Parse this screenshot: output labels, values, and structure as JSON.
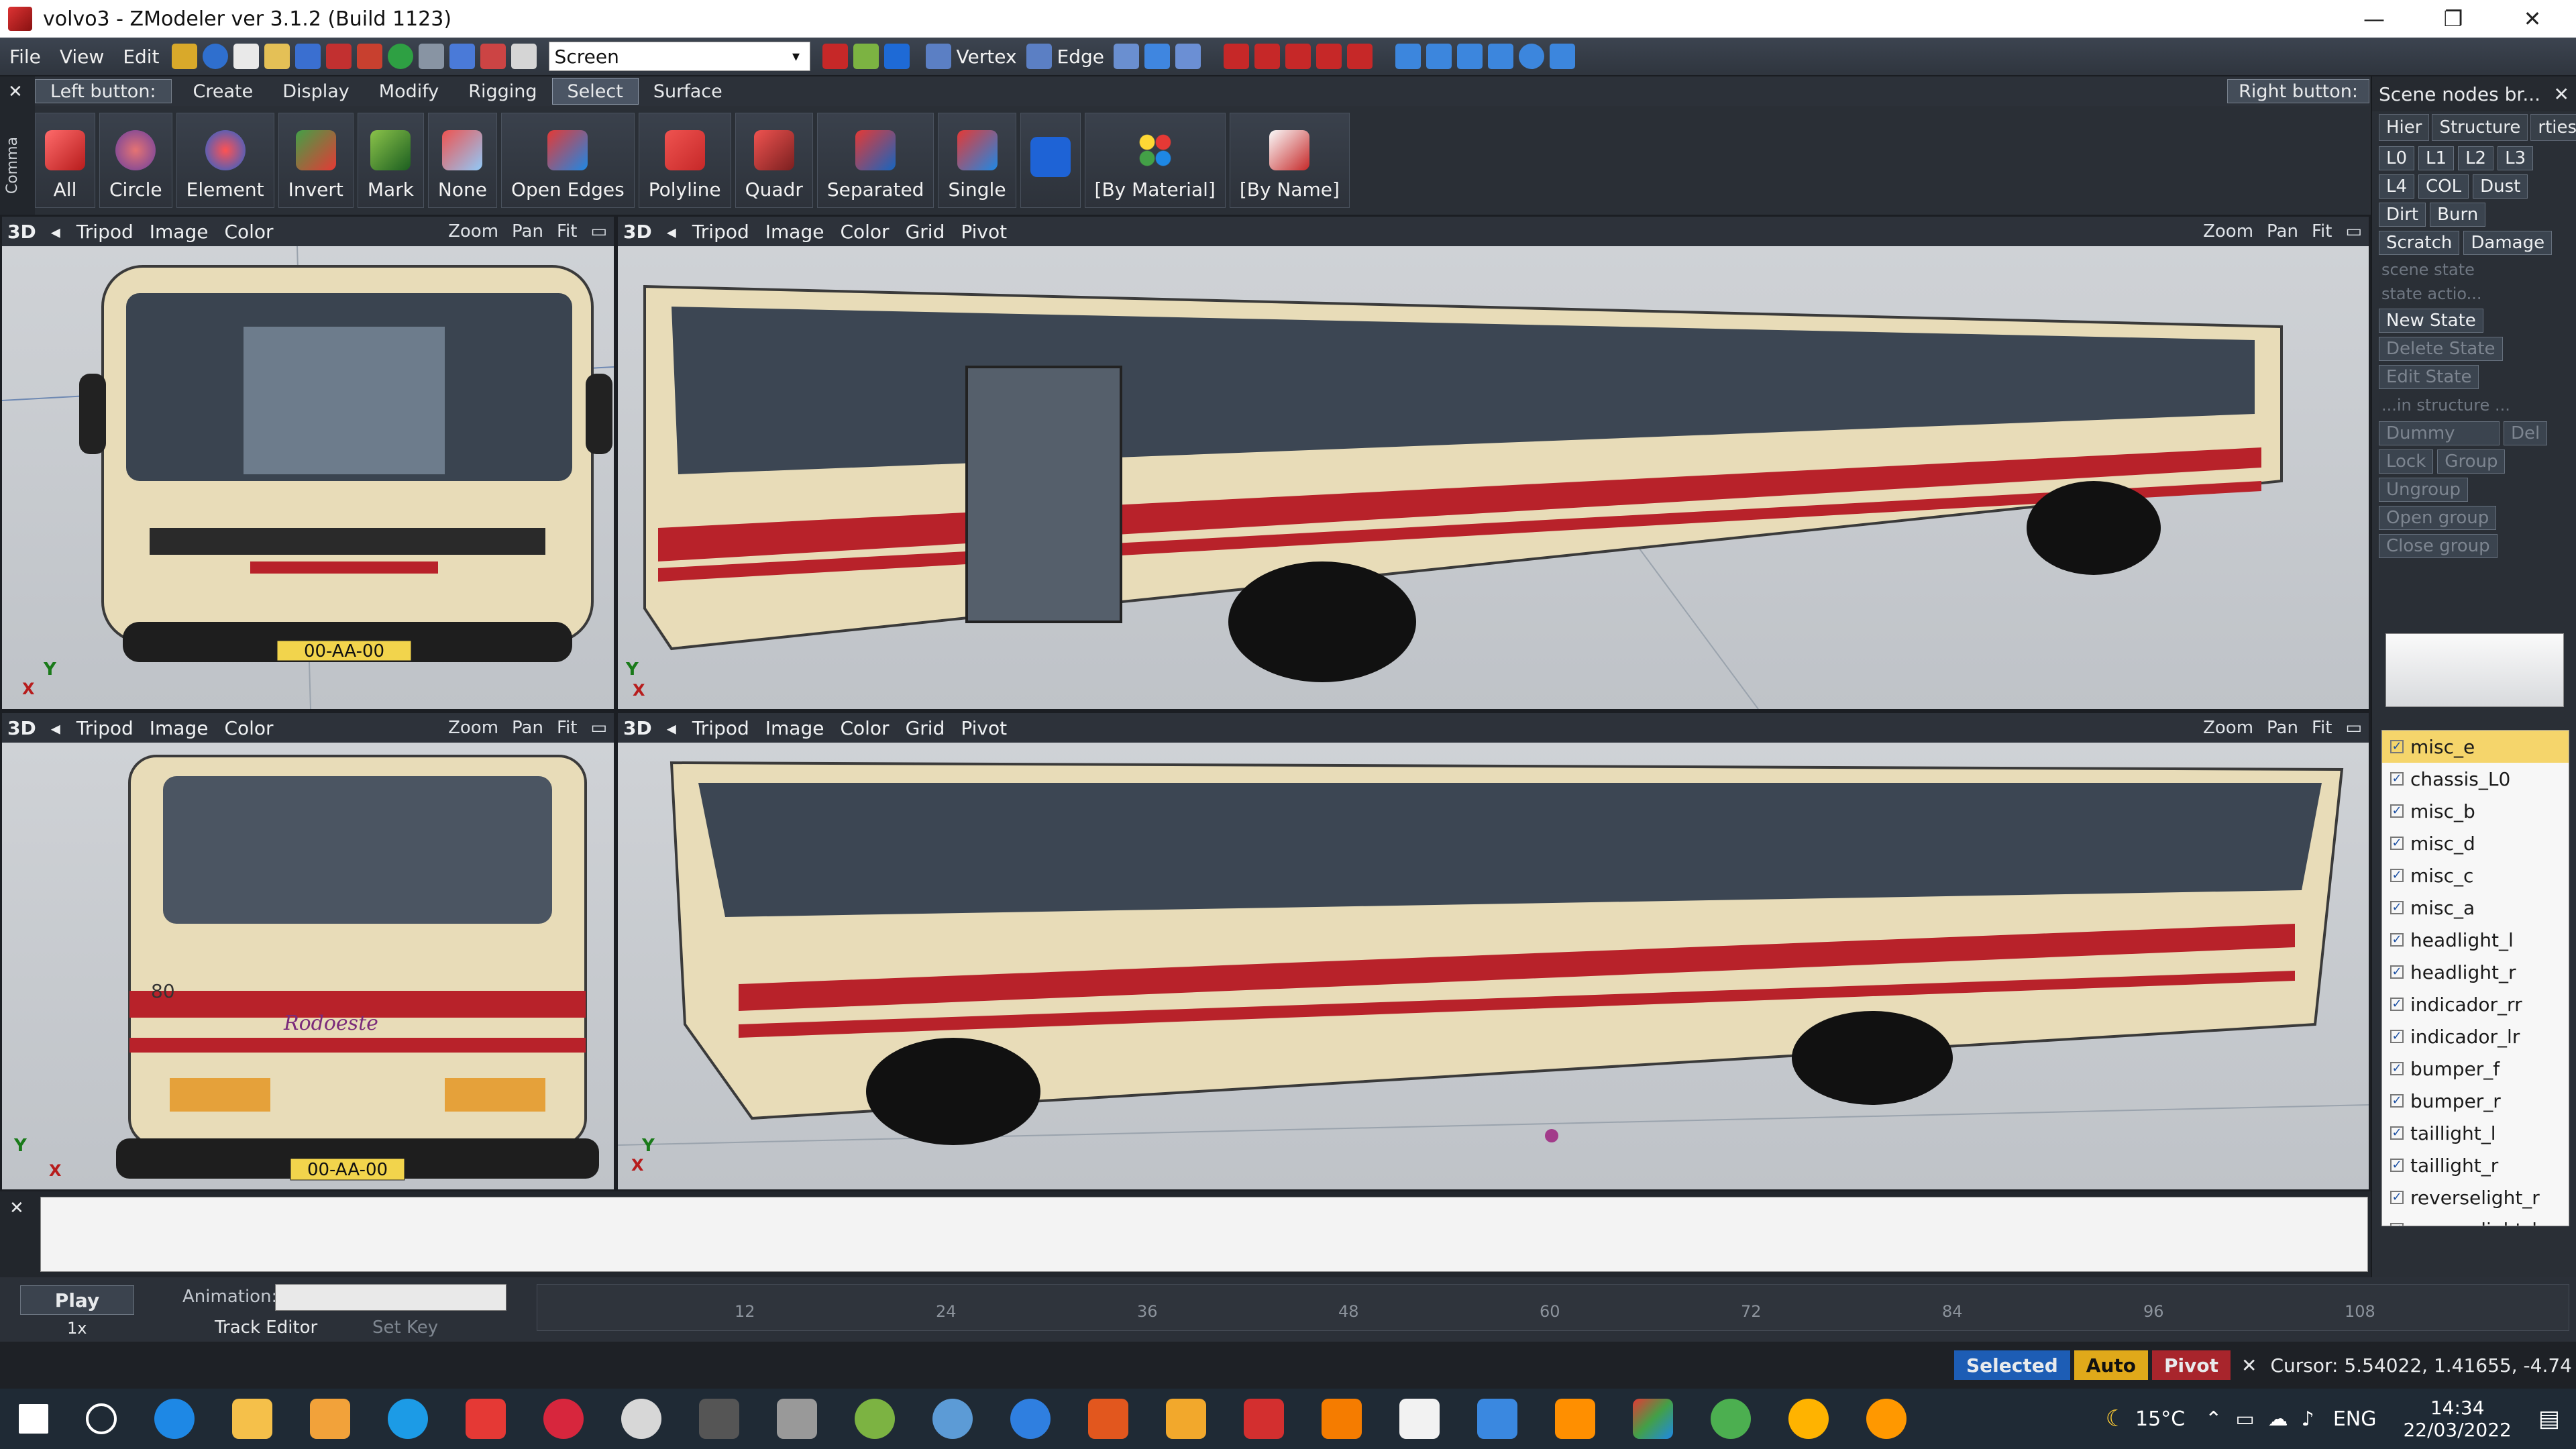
{
  "window": {
    "title": "volvo3 - ZModeler ver 3.1.2 (Build 1123)",
    "minimize": "—",
    "maximize": "❐",
    "close": "✕"
  },
  "menu": {
    "items": [
      "File",
      "View",
      "Edit"
    ],
    "screen_combo": "Screen",
    "vertex_label": "Vertex",
    "edge_label": "Edge"
  },
  "tabs": {
    "left_button": "Left button:",
    "items": [
      "Create",
      "Display",
      "Modify",
      "Rigging",
      "Select",
      "Surface"
    ],
    "active": "Select",
    "right_button": "Right button:",
    "command_strip": "Comma"
  },
  "select_tools": [
    "All",
    "Circle",
    "Element",
    "Invert",
    "Mark",
    "None",
    "Open Edges",
    "Polyline",
    "Quadr",
    "Separated",
    "Single",
    "[By Material]",
    "[By Name]"
  ],
  "viewport_bar": {
    "mode": "3D",
    "left_items": [
      "Tripod",
      "Image",
      "Color"
    ],
    "right_items": [
      "Tripod",
      "Image",
      "Color",
      "Grid",
      "Pivot"
    ],
    "zoom": "Zoom",
    "pan": "Pan",
    "fit": "Fit",
    "axis_y": "Y",
    "axis_x": "X",
    "plate": "00-AA-00",
    "bus_number": "80",
    "operator": "Rodoeste"
  },
  "right_panel": {
    "title": "Scene nodes br...",
    "tabs": [
      "Hier",
      "Structure",
      "rties"
    ],
    "lod_buttons": [
      "L0",
      "L1",
      "L2",
      "L3",
      "L4",
      "COL"
    ],
    "state_buttons": [
      "Dust",
      "Dirt",
      "Burn",
      "Scratch"
    ],
    "damage": "Damage",
    "scene_state": "scene state",
    "state_action": "state actio...",
    "new_state": "New State",
    "delete_state": "Delete State",
    "edit_state": "Edit State",
    "in_structure": "...in structure ...",
    "del": "Del",
    "lock": "Lock",
    "dummy": "Dummy",
    "group": "Group",
    "ungroup": "Ungroup",
    "open_group": "Open group",
    "close_group": "Close group",
    "nodes": [
      "misc_e",
      "chassis_L0",
      "misc_b",
      "misc_d",
      "misc_c",
      "misc_a",
      "headlight_l",
      "headlight_r",
      "indicador_rr",
      "indicador_lr",
      "bumper_f",
      "bumper_r",
      "taillight_l",
      "taillight_r",
      "reverselight_r",
      "reverselight_l"
    ],
    "selected_node": "misc_e"
  },
  "animation": {
    "play": "Play",
    "speed": "1x",
    "label": "Animation:",
    "track_editor": "Track Editor",
    "set_key": "Set Key",
    "ticks": [
      "12",
      "24",
      "36",
      "48",
      "60",
      "72",
      "84",
      "96",
      "108"
    ]
  },
  "status": {
    "selected": "Selected",
    "auto": "Auto",
    "pivot": "Pivot",
    "cursor": "Cursor: 5.54022, 1.41655, -4.74"
  },
  "taskbar": {
    "temperature": "15°C",
    "language": "ENG",
    "time": "14:34",
    "date": "22/03/2022"
  },
  "colors": {
    "bus_body": "#e8dcb8",
    "bus_stripe": "#b8222a",
    "viewport_bg": "#c9cdd2",
    "selected_row": "#f5d56b",
    "status_selected": "#1d5db5",
    "status_auto": "#e0a91a",
    "status_pivot": "#a8252c"
  }
}
